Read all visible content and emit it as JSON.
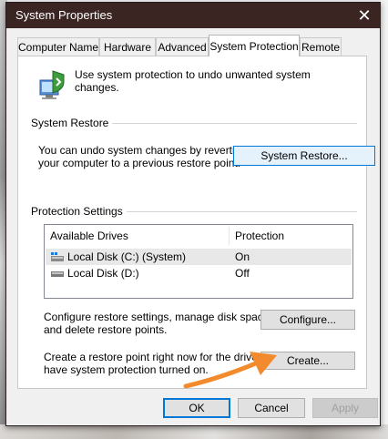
{
  "window": {
    "title": "System Properties",
    "close_label": "✕"
  },
  "tabs": [
    {
      "label": "Computer Name"
    },
    {
      "label": "Hardware"
    },
    {
      "label": "Advanced"
    },
    {
      "label": "System Protection",
      "active": true
    },
    {
      "label": "Remote"
    }
  ],
  "intro_text": "Use system protection to undo unwanted system changes.",
  "system_restore": {
    "heading": "System Restore",
    "description_line1": "You can undo system changes by reverting",
    "description_line2": "your computer to a previous restore point.",
    "button_label": "System Restore..."
  },
  "protection_settings": {
    "heading": "Protection Settings",
    "columns": [
      "Available Drives",
      "Protection"
    ],
    "drives": [
      {
        "name": "Local Disk (C:) (System)",
        "protection": "On",
        "selected": true,
        "icon": "system-drive-icon"
      },
      {
        "name": "Local Disk (D:)",
        "protection": "Off",
        "selected": false,
        "icon": "drive-icon"
      }
    ],
    "configure_text_line1": "Configure restore settings, manage disk space,",
    "configure_text_line2": "and delete restore points.",
    "configure_button": "Configure...",
    "create_text_line1": "Create a restore point right now for the drives that",
    "create_text_line2": "have system protection turned on.",
    "create_button": "Create..."
  },
  "footer": {
    "ok": "OK",
    "cancel": "Cancel",
    "apply": "Apply"
  },
  "colors": {
    "titlebar": "#3a2523",
    "accent": "#0078d7",
    "arrow": "#f28a2e"
  }
}
